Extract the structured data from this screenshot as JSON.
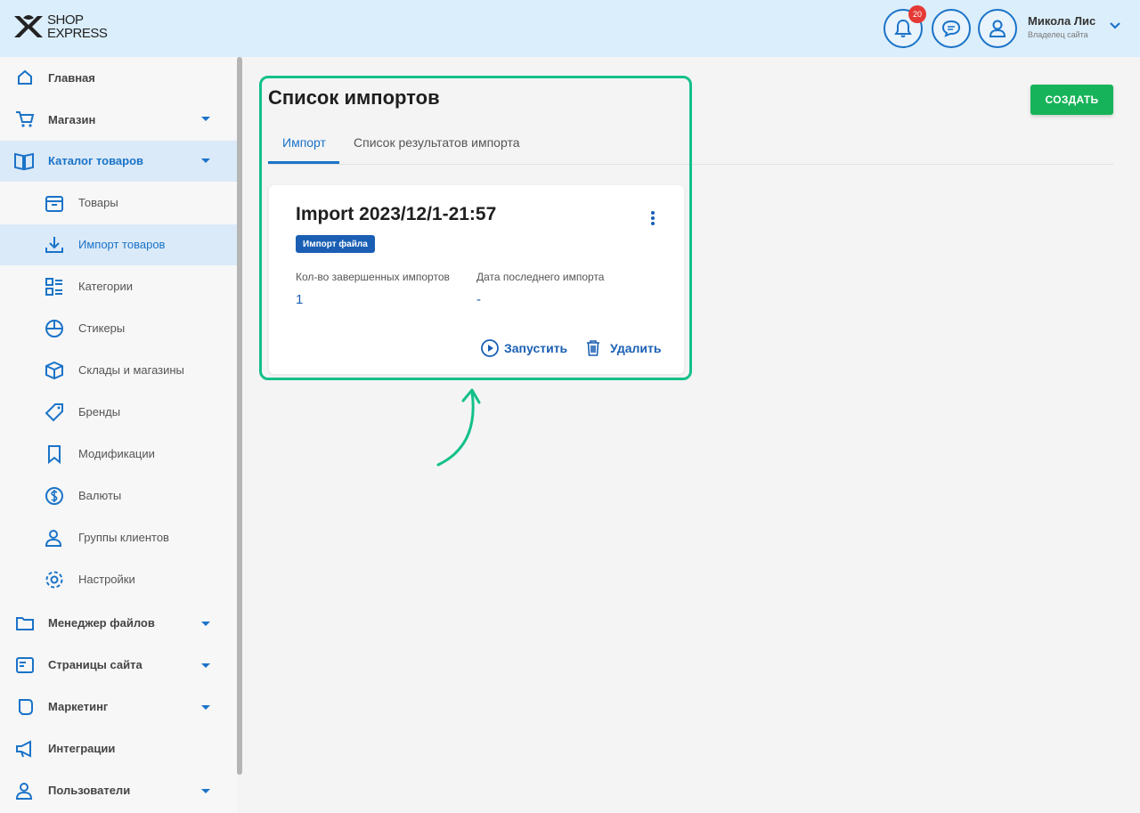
{
  "header": {
    "logo_line1": "SHOP",
    "logo_line2": "EXPRESS",
    "notification_count": "20",
    "user_name": "Микола Лис",
    "user_role": "Владелец сайта"
  },
  "sidebar": {
    "items": [
      {
        "label": "Главная",
        "icon": "home-icon"
      },
      {
        "label": "Магазин",
        "icon": "cart-icon"
      },
      {
        "label": "Каталог товаров",
        "icon": "book-icon"
      },
      {
        "label": "Товары",
        "icon": "box-icon"
      },
      {
        "label": "Импорт товаров",
        "icon": "download-icon"
      },
      {
        "label": "Категории",
        "icon": "categories-icon"
      },
      {
        "label": "Стикеры",
        "icon": "sticker-icon"
      },
      {
        "label": "Склады и магазины",
        "icon": "warehouse-icon"
      },
      {
        "label": "Бренды",
        "icon": "tag-icon"
      },
      {
        "label": "Модификации",
        "icon": "bookmark-icon"
      },
      {
        "label": "Валюты",
        "icon": "currency-icon"
      },
      {
        "label": "Группы клиентов",
        "icon": "user-group-icon"
      },
      {
        "label": "Настройки",
        "icon": "gear-icon"
      },
      {
        "label": "Менеджер файлов",
        "icon": "folder-icon"
      },
      {
        "label": "Страницы сайта",
        "icon": "page-icon"
      },
      {
        "label": "Маркетинг",
        "icon": "marketing-icon"
      },
      {
        "label": "Интеграции",
        "icon": "megaphone-icon"
      },
      {
        "label": "Пользователи",
        "icon": "users-icon"
      }
    ]
  },
  "main": {
    "title": "Список импортов",
    "create_label": "СОЗДАТЬ",
    "tabs": [
      {
        "label": "Импорт"
      },
      {
        "label": "Список результатов импорта"
      }
    ],
    "card": {
      "title": "Import 2023/12/1-21:57",
      "chip": "Импорт файла",
      "completed_label": "Кол-во завершенных импортов",
      "completed_value": "1",
      "last_date_label": "Дата последнего импорта",
      "last_date_value": "-",
      "run_label": "Запустить",
      "delete_label": "Удалить"
    }
  },
  "colors": {
    "accent": "#1a73c8",
    "create_button": "#17b35a",
    "highlight": "#14c08a"
  }
}
